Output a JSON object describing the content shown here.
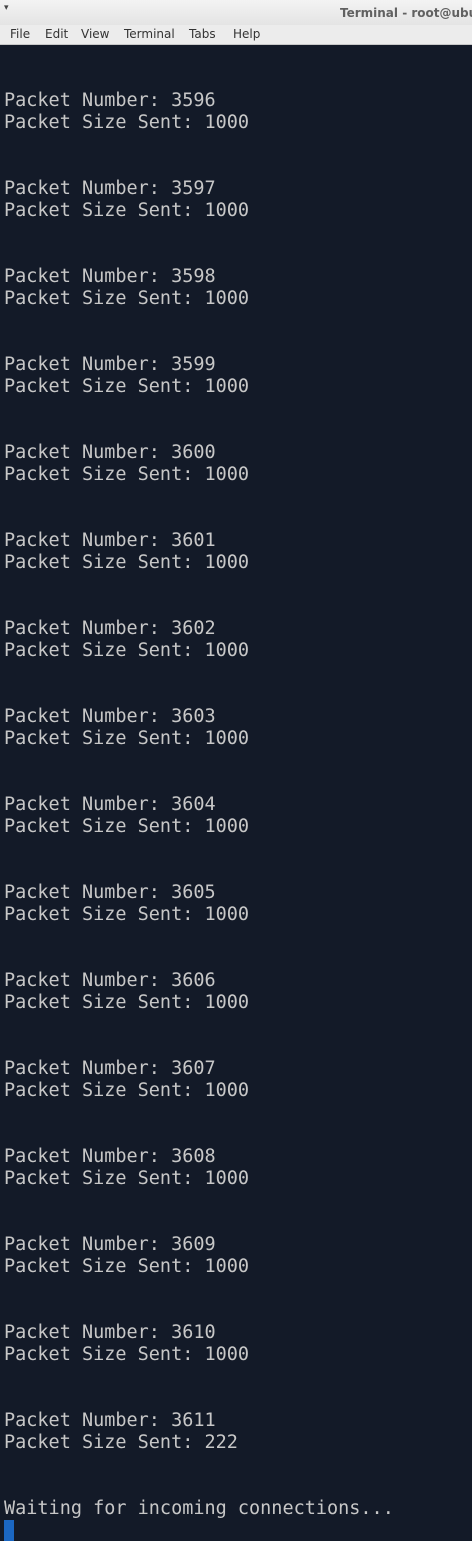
{
  "window": {
    "title": "Terminal - root@ubu",
    "menu_chevron": "▾"
  },
  "menu": {
    "items": [
      "File",
      "Edit",
      "View",
      "Terminal",
      "Tabs",
      "Help"
    ]
  },
  "terminal": {
    "lines": [
      "Packet Number: 3596",
      "Packet Size Sent: 1000",
      "Packet Number: 3597",
      "Packet Size Sent: 1000",
      "Packet Number: 3598",
      "Packet Size Sent: 1000",
      "Packet Number: 3599",
      "Packet Size Sent: 1000",
      "Packet Number: 3600",
      "Packet Size Sent: 1000",
      "Packet Number: 3601",
      "Packet Size Sent: 1000",
      "Packet Number: 3602",
      "Packet Size Sent: 1000",
      "Packet Number: 3603",
      "Packet Size Sent: 1000",
      "Packet Number: 3604",
      "Packet Size Sent: 1000",
      "Packet Number: 3605",
      "Packet Size Sent: 1000",
      "Packet Number: 3606",
      "Packet Size Sent: 1000",
      "Packet Number: 3607",
      "Packet Size Sent: 1000",
      "Packet Number: 3608",
      "Packet Size Sent: 1000",
      "Packet Number: 3609",
      "Packet Size Sent: 1000",
      "Packet Number: 3610",
      "Packet Size Sent: 1000",
      "Packet Number: 3611",
      "Packet Size Sent: 222",
      "Waiting for incoming connections..."
    ]
  },
  "colors": {
    "terminal_background": "#131a28",
    "terminal_text": "#c7c7c7",
    "cursor": "#1b67c2"
  }
}
